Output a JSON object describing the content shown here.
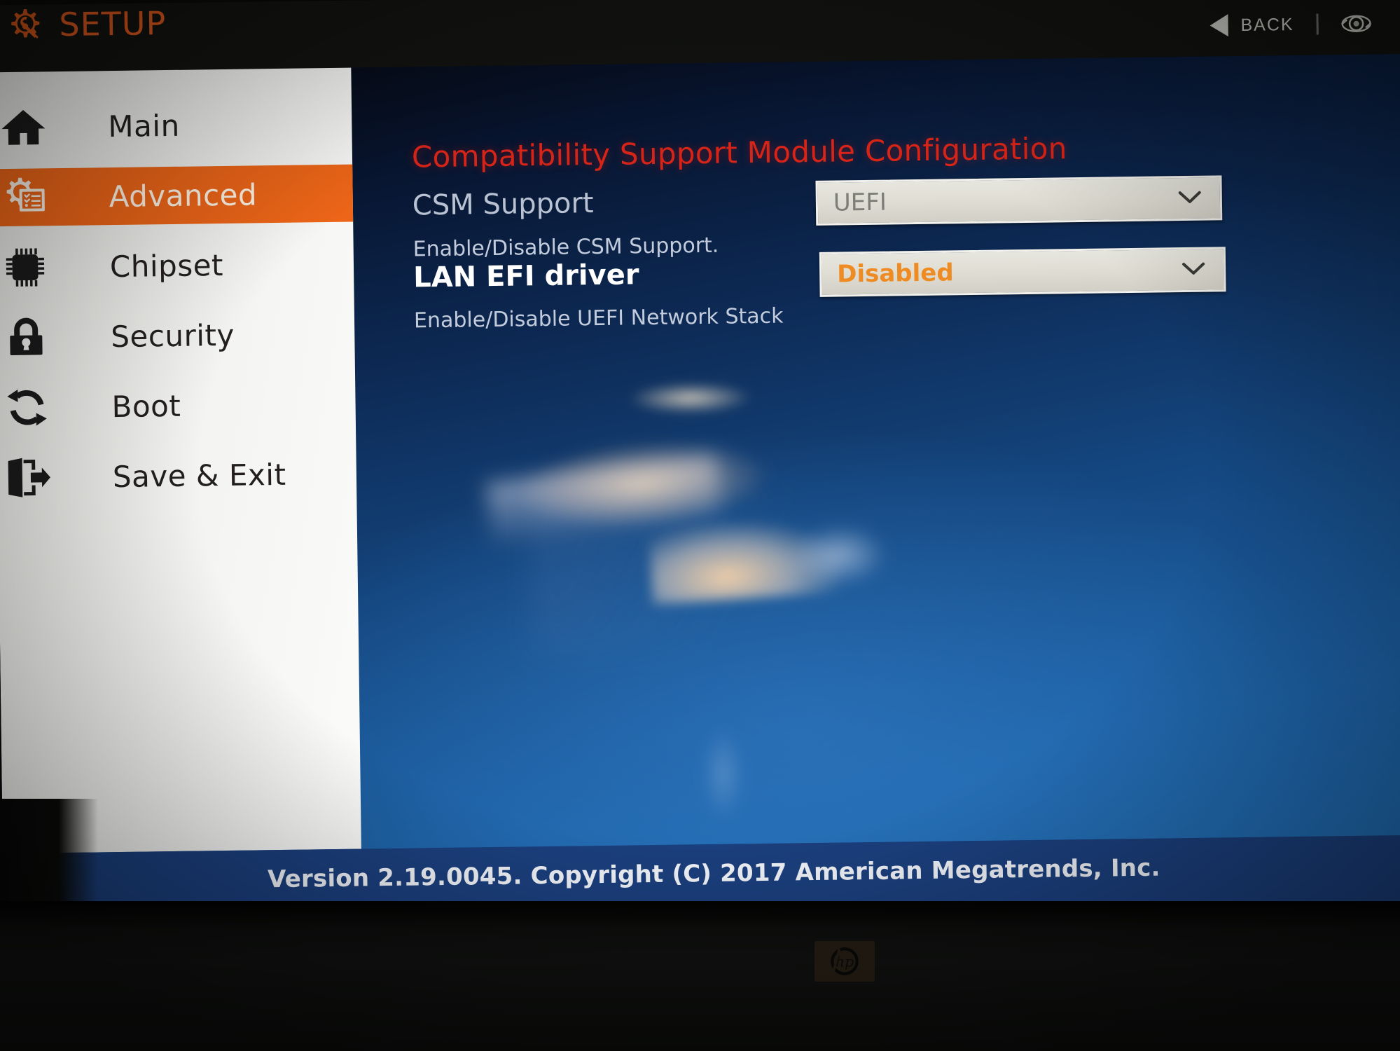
{
  "header": {
    "logo_icon": "gear-wrench-icon",
    "title": "SETUP",
    "back_label": "BACK",
    "back_icon": "left-triangle-icon",
    "settings_icon": "gear-settings-icon",
    "accent_orange": "#d4541c"
  },
  "sidebar": {
    "items": [
      {
        "label": "Main",
        "icon": "home-icon",
        "active": false
      },
      {
        "label": "Advanced",
        "icon": "gear-list-icon",
        "active": true
      },
      {
        "label": "Chipset",
        "icon": "cpu-chip-icon",
        "active": false
      },
      {
        "label": "Security",
        "icon": "padlock-icon",
        "active": false
      },
      {
        "label": "Boot",
        "icon": "refresh-arrows-icon",
        "active": false
      },
      {
        "label": "Save & Exit",
        "icon": "exit-door-icon",
        "active": false
      }
    ],
    "active_color": "#ec6518",
    "background_color": "#f2f3f0"
  },
  "main": {
    "section_title": "Compatibility Support Module Configuration",
    "section_title_color": "#d62418",
    "options": [
      {
        "label": "CSM Support",
        "description": "Enable/Disable CSM Support.",
        "value": "UEFI",
        "value_color": "#7e7e78",
        "focused": false,
        "chevron_icon": "chevron-down-icon"
      },
      {
        "label": "LAN EFI driver",
        "description": "Enable/Disable UEFI Network Stack",
        "value": "Disabled",
        "value_color": "#ee8b22",
        "focused": true,
        "chevron_icon": "chevron-down-icon"
      }
    ]
  },
  "footer": {
    "version_text": "Version 2.19.0045. Copyright (C) 2017 American Megatrends, Inc."
  },
  "bezel": {
    "brand_logo": "hp-logo"
  }
}
